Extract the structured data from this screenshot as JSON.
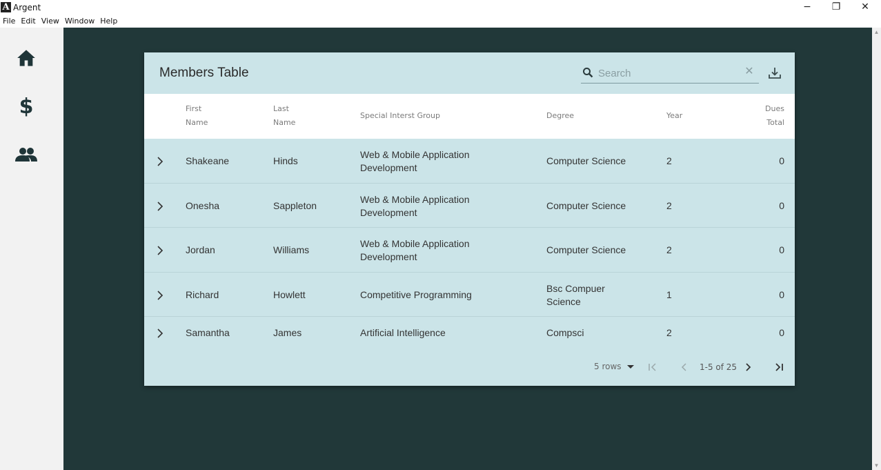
{
  "window": {
    "logo_letter": "A",
    "title": "Argent",
    "controls": {
      "minimize": "−",
      "maximize": "❐",
      "close": "✕"
    }
  },
  "menu": [
    "File",
    "Edit",
    "View",
    "Window",
    "Help"
  ],
  "nav": {
    "dues_symbol": "$"
  },
  "table": {
    "title": "Members Table",
    "search_placeholder": "Search",
    "columns": {
      "first_name_1": "First",
      "first_name_2": "Name",
      "last_name_1": "Last",
      "last_name_2": "Name",
      "sig": "Special Interst Group",
      "degree": "Degree",
      "year": "Year",
      "dues_1": "Dues",
      "dues_2": "Total"
    },
    "rows": [
      {
        "first": "Shakeane",
        "last": "Hinds",
        "sig1": "Web & Mobile Application",
        "sig2": "Development",
        "deg1": "Computer Science",
        "deg2": "",
        "year": "2",
        "dues": "0"
      },
      {
        "first": "Onesha",
        "last": "Sappleton",
        "sig1": "Web & Mobile Application",
        "sig2": "Development",
        "deg1": "Computer Science",
        "deg2": "",
        "year": "2",
        "dues": "0"
      },
      {
        "first": "Jordan",
        "last": "Williams",
        "sig1": "Web & Mobile Application",
        "sig2": "Development",
        "deg1": "Computer Science",
        "deg2": "",
        "year": "2",
        "dues": "0"
      },
      {
        "first": "Richard",
        "last": "Howlett",
        "sig1": "Competitive Programming",
        "sig2": "",
        "deg1": "Bsc Compuer",
        "deg2": "Science",
        "year": "1",
        "dues": "0"
      },
      {
        "first": "Samantha",
        "last": "James",
        "sig1": "Artificial Intelligence",
        "sig2": "",
        "deg1": "Compsci",
        "deg2": "",
        "year": "2",
        "dues": "0"
      }
    ],
    "pagination": {
      "rows_per_page": "5 rows",
      "range": "1-5 of 25"
    }
  },
  "colors": {
    "main_bg": "#213839",
    "card_bg": "#cbe4e8",
    "nav_icon": "#1f3538"
  }
}
